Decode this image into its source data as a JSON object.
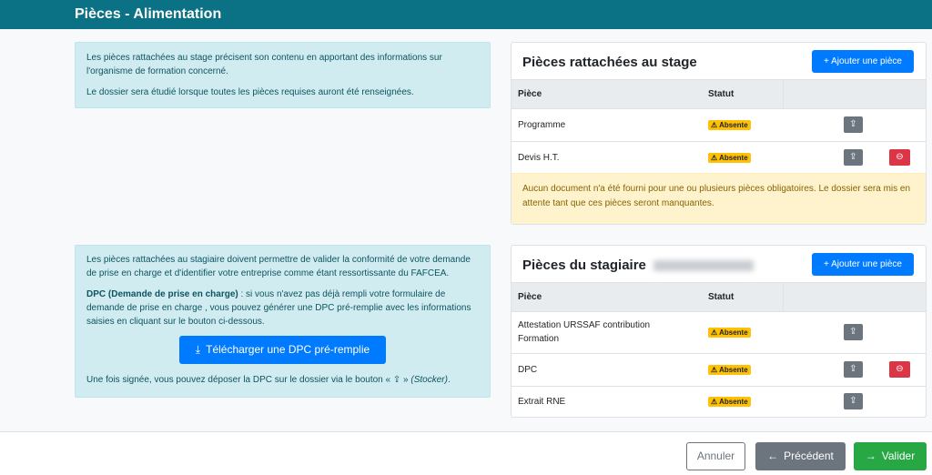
{
  "header": {
    "title": "Pièces - Alimentation"
  },
  "info_stage": {
    "p1": "Les pièces rattachées au stage précisent son contenu en apportant des informations sur l'organisme de formation concerné.",
    "p2": "Le dossier sera étudié lorsque toutes les pièces requises auront été renseignées."
  },
  "info_stagiaire": {
    "p1": "Les pièces rattachées au stagiaire doivent permettre de valider la conformité de votre demande de prise en charge et d'identifier votre entreprise comme étant ressortissante du FAFCEA.",
    "dpc_label": "DPC (Demande de prise en charge)",
    "dpc_text": " : si vous n'avez pas déjà rempli votre formulaire de demande de prise en charge , vous pouvez générer une DPC pré-remplie avec les informations saisies en cliquant sur le bouton ci-dessous.",
    "download_button": "Télécharger une DPC pré-remplie",
    "p3_start": "Une fois signée, vous pouvez déposer la DPC sur le dossier via le bouton « ",
    "p3_end": " » ",
    "p3_stocker": "(Stocker)",
    "p3_dot": "."
  },
  "card_stage": {
    "title": "Pièces rattachées au stage",
    "add_button": "+ Ajouter une pièce",
    "col_piece": "Pièce",
    "col_statut": "Statut",
    "rows": [
      {
        "piece": "Programme",
        "statut": "⚠ Absente"
      },
      {
        "piece": "Devis H.T.",
        "statut": "⚠ Absente"
      }
    ],
    "warning": "Aucun document n'a été fourni pour une ou plusieurs pièces obligatoires. Le dossier sera mis en attente tant que ces pièces seront manquantes."
  },
  "card_stagiaire": {
    "title": "Pièces du stagiaire",
    "add_button": "+ Ajouter une pièce",
    "col_piece": "Pièce",
    "col_statut": "Statut",
    "rows": [
      {
        "piece": "Attestation URSSAF contribution Formation",
        "statut": "⚠ Absente"
      },
      {
        "piece": "DPC",
        "statut": "⚠ Absente"
      },
      {
        "piece": "Extrait RNE",
        "statut": "⚠ Absente"
      }
    ]
  },
  "footer": {
    "cancel": "Annuler",
    "prev": "Précédent",
    "next": "Valider"
  },
  "colors": {
    "header": "#0b7285",
    "primary": "#007bff",
    "success": "#28a745",
    "danger": "#dc3545",
    "warning": "#ffc107"
  }
}
